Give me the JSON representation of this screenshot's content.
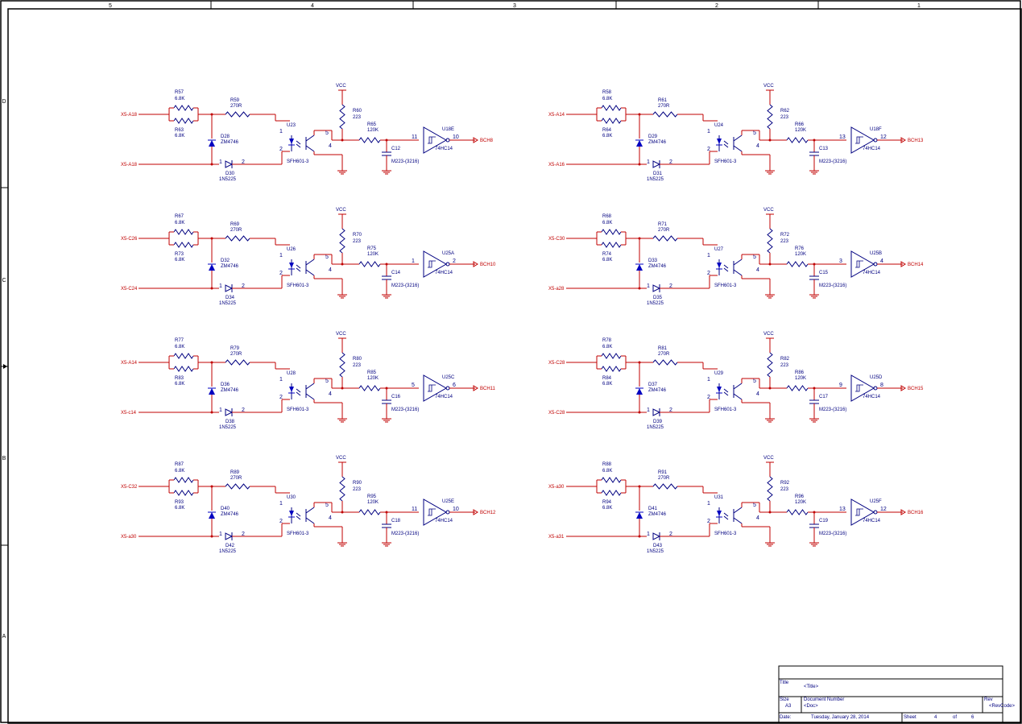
{
  "frame": {
    "columns": [
      "5",
      "4",
      "3",
      "2",
      "1"
    ],
    "rows": [
      "D",
      "C",
      "B",
      "A"
    ]
  },
  "title_block": {
    "title_label": "Title",
    "title_value": "<Title>",
    "size_label": "Size",
    "size_value": "A3",
    "docnum_label": "Document Number",
    "docnum_value": "<Doc>",
    "rev_label": "Rev",
    "rev_value": "<RevCode>",
    "date_label": "Date:",
    "date_value": "Tuesday, January 28, 2014",
    "sheet_label": "Sheet",
    "sheet_num": "4",
    "of_label": "of",
    "sheet_total": "6"
  },
  "colors": {
    "wire": "#c00000",
    "component": "#000080",
    "diode": "#0000c0",
    "frame": "#000000"
  },
  "cells": [
    {
      "in_a": "X5-A18",
      "in_b": "X5-A18",
      "ra": "R57",
      "ra_val": "6.8K",
      "rb": "R63",
      "rb_val": "6.8K",
      "rs": "R59",
      "rs_val": "270R",
      "dz": "D28",
      "dz_val": "ZM4746",
      "d": "D30",
      "d_val": "1N5225",
      "u": "U23",
      "u_val": "SFH601-3",
      "vcc": "VCC",
      "rpu": "R60",
      "rpu_val": "223",
      "rf": "R65",
      "rf_val": "120K",
      "c": "C12",
      "c_val": "M223-(3216)",
      "g": "U18E",
      "g_val": "74HC14",
      "gi": "11",
      "go": "10",
      "out": "BCH8"
    },
    {
      "in_a": "X5-A14",
      "in_b": "X5-A16",
      "ra": "R58",
      "ra_val": "6.8K",
      "rb": "R64",
      "rb_val": "6.8K",
      "rs": "R61",
      "rs_val": "270R",
      "dz": "D29",
      "dz_val": "ZM4746",
      "d": "D31",
      "d_val": "1N5225",
      "u": "U24",
      "u_val": "SFH601-3",
      "vcc": "VCC",
      "rpu": "R62",
      "rpu_val": "223",
      "rf": "R66",
      "rf_val": "120K",
      "c": "C13",
      "c_val": "M223-(3216)",
      "g": "U18F",
      "g_val": "74HC14",
      "gi": "13",
      "go": "12",
      "out": "BCH13"
    },
    {
      "in_a": "X5-C26",
      "in_b": "X5-C24",
      "ra": "R67",
      "ra_val": "6.8K",
      "rb": "R73",
      "rb_val": "6.8K",
      "rs": "R69",
      "rs_val": "270R",
      "dz": "D32",
      "dz_val": "ZM4746",
      "d": "D34",
      "d_val": "1N5225",
      "u": "U26",
      "u_val": "SFH601-3",
      "vcc": "VCC",
      "rpu": "R70",
      "rpu_val": "223",
      "rf": "R75",
      "rf_val": "120K",
      "c": "C14",
      "c_val": "M223-(3216)",
      "g": "U25A",
      "g_val": "74HC14",
      "gi": "1",
      "go": "2",
      "out": "BCH10"
    },
    {
      "in_a": "X5-C30",
      "in_b": "X5-a28",
      "ra": "R68",
      "ra_val": "6.8K",
      "rb": "R74",
      "rb_val": "6.8K",
      "rs": "R71",
      "rs_val": "270R",
      "dz": "D33",
      "dz_val": "ZM4746",
      "d": "D35",
      "d_val": "1N5225",
      "u": "U27",
      "u_val": "SFH601-3",
      "vcc": "VCC",
      "rpu": "R72",
      "rpu_val": "223",
      "rf": "R76",
      "rf_val": "120K",
      "c": "C15",
      "c_val": "M223-(3216)",
      "g": "U25B",
      "g_val": "74HC14",
      "gi": "3",
      "go": "4",
      "out": "BCH14"
    },
    {
      "in_a": "X5-A14",
      "in_b": "X5-c14",
      "ra": "R77",
      "ra_val": "6.8K",
      "rb": "R83",
      "rb_val": "6.8K",
      "rs": "R79",
      "rs_val": "270R",
      "dz": "D36",
      "dz_val": "ZM4746",
      "d": "D38",
      "d_val": "1N5225",
      "u": "U28",
      "u_val": "SFH601-3",
      "vcc": "VCC",
      "rpu": "R80",
      "rpu_val": "223",
      "rf": "R85",
      "rf_val": "120K",
      "c": "C16",
      "c_val": "M223-(3216)",
      "g": "U25C",
      "g_val": "74HC14",
      "gi": "5",
      "go": "6",
      "out": "BCH11"
    },
    {
      "in_a": "X5-C28",
      "in_b": "X5-C28",
      "ra": "R78",
      "ra_val": "6.8K",
      "rb": "R84",
      "rb_val": "6.8K",
      "rs": "R81",
      "rs_val": "270R",
      "dz": "D37",
      "dz_val": "ZM4746",
      "d": "D39",
      "d_val": "1N5225",
      "u": "U29",
      "u_val": "SFH601-3",
      "vcc": "VCC",
      "rpu": "R82",
      "rpu_val": "223",
      "rf": "R86",
      "rf_val": "120K",
      "c": "C17",
      "c_val": "M223-(3216)",
      "g": "U25D",
      "g_val": "74HC14",
      "gi": "9",
      "go": "8",
      "out": "BCH15"
    },
    {
      "in_a": "X5-C32",
      "in_b": "X5-a30",
      "ra": "R87",
      "ra_val": "6.8K",
      "rb": "R93",
      "rb_val": "6.8K",
      "rs": "R89",
      "rs_val": "270R",
      "dz": "D40",
      "dz_val": "ZM4746",
      "d": "D42",
      "d_val": "1N5225",
      "u": "U30",
      "u_val": "SFH601-3",
      "vcc": "VCC",
      "rpu": "R90",
      "rpu_val": "223",
      "rf": "R95",
      "rf_val": "120K",
      "c": "C18",
      "c_val": "M223-(3216)",
      "g": "U25E",
      "g_val": "74HC14",
      "gi": "11",
      "go": "10",
      "out": "BCH12"
    },
    {
      "in_a": "X5-a30",
      "in_b": "X5-a31",
      "ra": "R88",
      "ra_val": "6.8K",
      "rb": "R94",
      "rb_val": "6.8K",
      "rs": "R91",
      "rs_val": "270R",
      "dz": "D41",
      "dz_val": "ZM4746",
      "d": "D43",
      "d_val": "1N5225",
      "u": "U31",
      "u_val": "SFH601-3",
      "vcc": "VCC",
      "rpu": "R92",
      "rpu_val": "223",
      "rf": "R96",
      "rf_val": "120K",
      "c": "C19",
      "c_val": "M223-(3216)",
      "g": "U25F",
      "g_val": "74HC14",
      "gi": "13",
      "go": "12",
      "out": "BCH16"
    }
  ]
}
